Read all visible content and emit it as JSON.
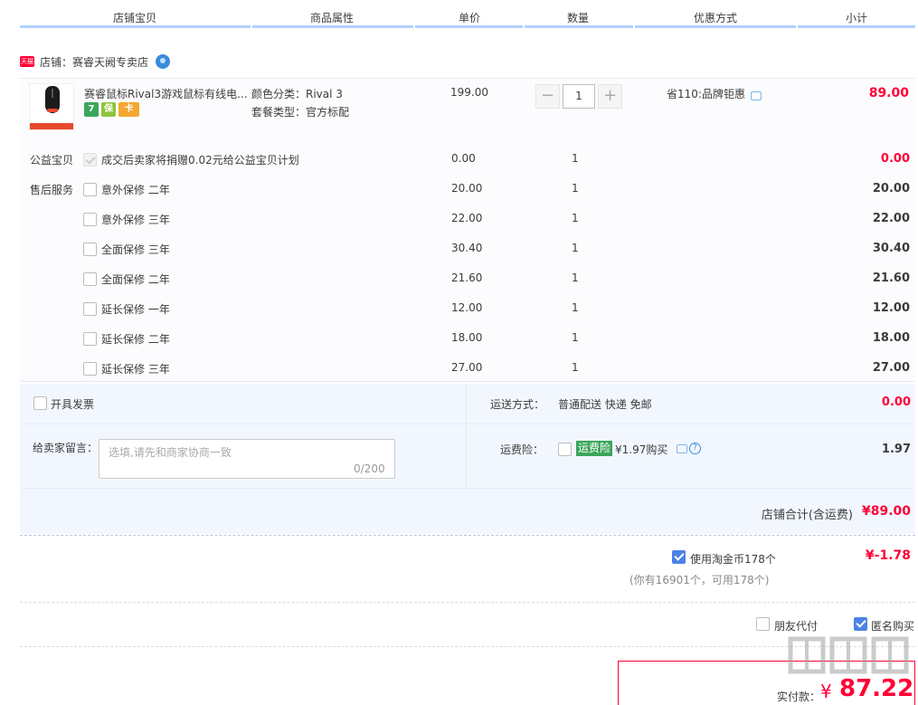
{
  "header": {
    "columns": [
      "店铺宝贝",
      "商品属性",
      "单价",
      "数量",
      "优惠方式",
      "小计"
    ]
  },
  "shop": {
    "badge": "天猫",
    "label": "店铺：赛睿天阙专卖店"
  },
  "item": {
    "title": "赛睿鼠标Rival3游戏鼠标有线电...",
    "tags": [
      "7",
      "保",
      "卡"
    ],
    "attr_color": "颜色分类：Rival 3",
    "attr_package": "套餐类型：官方标配",
    "price": "199.00",
    "quantity": "1",
    "minus": "−",
    "plus": "+",
    "promo": "省110:品牌钜惠",
    "subtotal": "89.00"
  },
  "services": [
    {
      "label": "公益宝贝",
      "name": "成交后卖家将捐赠0.02元给公益宝贝计划",
      "price": "0.00",
      "qty": "1",
      "subtotal": "0.00",
      "disabled": true
    },
    {
      "label": "售后服务",
      "name": "意外保修 二年",
      "price": "20.00",
      "qty": "1",
      "subtotal": "20.00"
    },
    {
      "label": "",
      "name": "意外保修 三年",
      "price": "22.00",
      "qty": "1",
      "subtotal": "22.00"
    },
    {
      "label": "",
      "name": "全面保修 三年",
      "price": "30.40",
      "qty": "1",
      "subtotal": "30.40"
    },
    {
      "label": "",
      "name": "全面保修 二年",
      "price": "21.60",
      "qty": "1",
      "subtotal": "21.60"
    },
    {
      "label": "",
      "name": "延长保修 一年",
      "price": "12.00",
      "qty": "1",
      "subtotal": "12.00"
    },
    {
      "label": "",
      "name": "延长保修 二年",
      "price": "18.00",
      "qty": "1",
      "subtotal": "18.00"
    },
    {
      "label": "",
      "name": "延长保修 三年",
      "price": "27.00",
      "qty": "1",
      "subtotal": "27.00"
    }
  ],
  "options": {
    "invoice_label": "开具发票",
    "shipping_label": "运送方式：",
    "shipping_value": "普通配送 快递 免邮",
    "shipping_price": "0.00",
    "message_label": "给卖家留言：",
    "message_placeholder": "选填,请先和商家协商一致",
    "message_count": "0/200",
    "insurance_label": "运费险：",
    "insurance_tag": "运费险",
    "insurance_price": "¥1.97购买",
    "insurance_fee": "1.97",
    "shop_total_label": "店铺合计(含运费)",
    "shop_total_value": "¥89.00"
  },
  "coins": {
    "label": "使用淘金币178个",
    "value": "¥-1.78",
    "note": "(你有16901个，可用178个)"
  },
  "extras": {
    "friend_pay": "朋友代付",
    "anonymous": "匿名购买"
  },
  "payment": {
    "label": "实付款：",
    "currency": "¥",
    "amount": "87.22"
  },
  "colors": {
    "accent_red": "#ff0036",
    "header_line": "#b2d1ff",
    "option_bg": "#f2f7ff",
    "check_blue": "#4d82e8"
  }
}
